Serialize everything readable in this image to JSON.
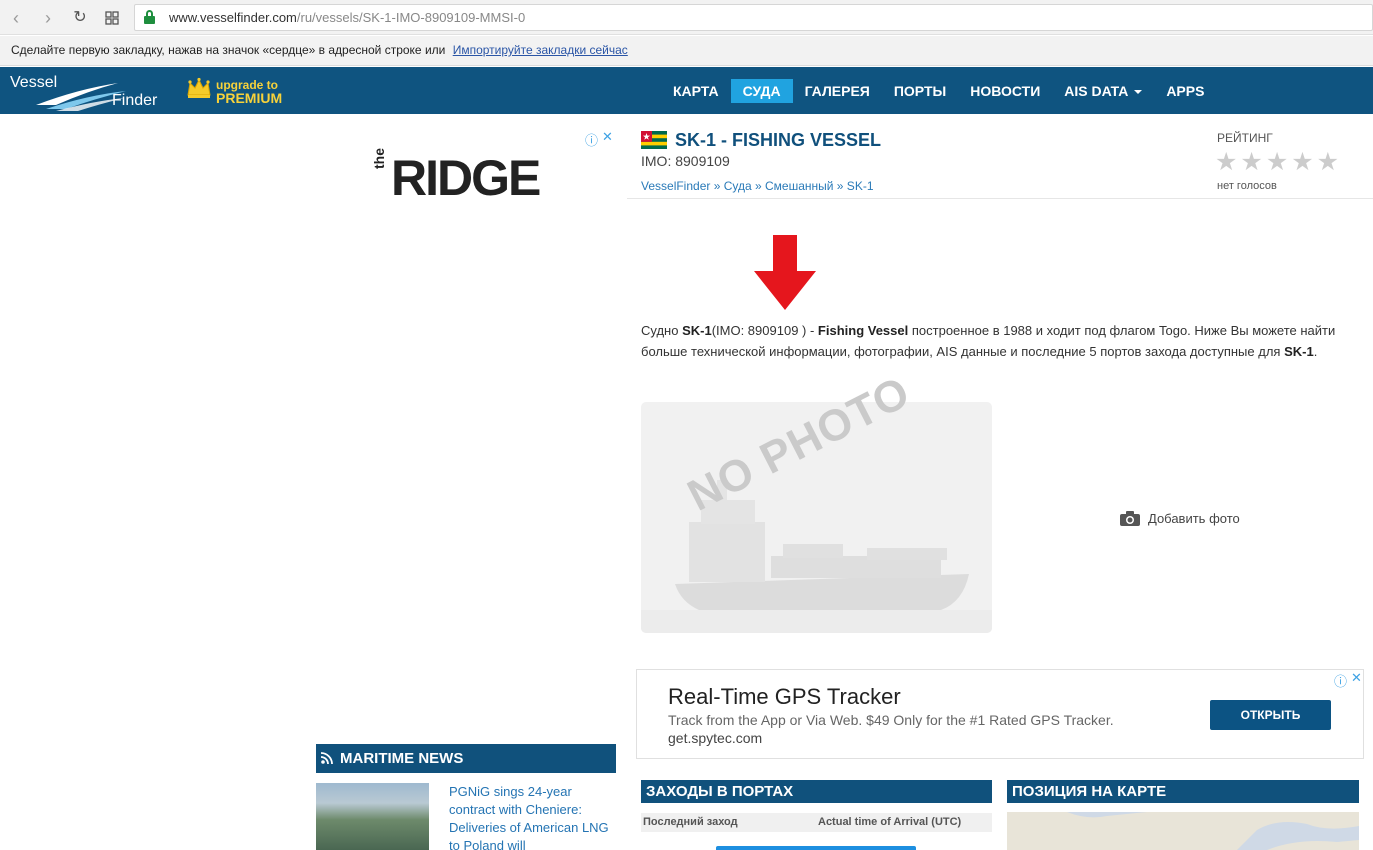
{
  "browser": {
    "url_domain": "www.vesselfinder.com",
    "url_path": "/ru/vessels/SK-1-IMO-8909109-MMSI-0",
    "bookmarks_text": "Сделайте первую закладку, нажав на значок «сердце» в адресной строке или",
    "bookmarks_link": "Импортируйте закладки сейчас"
  },
  "header": {
    "logo_top": "Vessel",
    "logo_bottom": "Finder",
    "premium_small": "upgrade to",
    "premium_big": "PREMIUM",
    "menu": [
      {
        "label": "КАРТА",
        "active": false
      },
      {
        "label": "СУДА",
        "active": true
      },
      {
        "label": "ГАЛЕРЕЯ",
        "active": false
      },
      {
        "label": "ПОРТЫ",
        "active": false
      },
      {
        "label": "НОВОСТИ",
        "active": false
      },
      {
        "label": "AIS DATA",
        "active": false
      },
      {
        "label": "APPS",
        "active": false
      }
    ]
  },
  "ad_left": {
    "brand_small": "the",
    "brand_big": "RIDGE"
  },
  "vessel": {
    "title": "SK-1 - FISHING VESSEL",
    "imo": "IMO: 8909109",
    "breadcrumbs": "VesselFinder » Суда » Смешанный » SK-1",
    "rating_label": "РЕЙТИНГ",
    "stars": "★★★★★",
    "votes": "нет голосов",
    "description": {
      "p1": "Судно ",
      "name": "SK-1",
      "p2": "(IMO: 8909109 ) - ",
      "type": "Fishing Vessel",
      "p3": " построенное в 1988 и ходит под флагом Togo. Ниже Вы можете найти больше технической информации, фотографии, AIS данные и последние 5 портов захода доступные для ",
      "name2": "SK-1",
      "p4": "."
    },
    "no_photo": "NO PHOTO",
    "add_photo": "Добавить фото"
  },
  "ad_gps": {
    "title": "Real-Time GPS Tracker",
    "subtitle": "Track from the App or Via Web. $49 Only for the #1 Rated GPS Tracker.",
    "url": "get.spytec.com",
    "button": "ОТКРЫТЬ"
  },
  "news": {
    "heading": "MARITIME NEWS",
    "item_text": "PGNiG sings 24-year contract with Cheniere: Deliveries of American LNG to Poland will"
  },
  "ports": {
    "heading": "ЗАХОДЫ В ПОРТАХ",
    "col1": "Последний заход",
    "col2": "Actual time of Arrival (UTC)"
  },
  "map": {
    "heading": "ПОЗИЦИЯ НА КАРТЕ"
  }
}
